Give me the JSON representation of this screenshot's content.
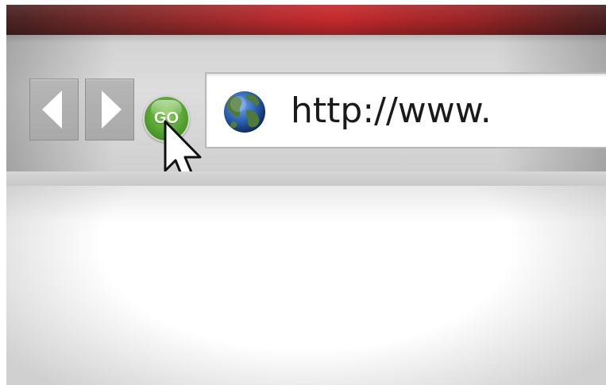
{
  "browser": {
    "navigation": {
      "back_icon": "back-arrow-icon",
      "forward_icon": "forward-arrow-icon"
    },
    "go_button": {
      "label": "GO",
      "color": "#5fad38"
    },
    "address_bar": {
      "icon": "globe-icon",
      "value": "http://www."
    },
    "cursor": "pointer-cursor-icon",
    "title_bar_color": "#c52b2e"
  }
}
